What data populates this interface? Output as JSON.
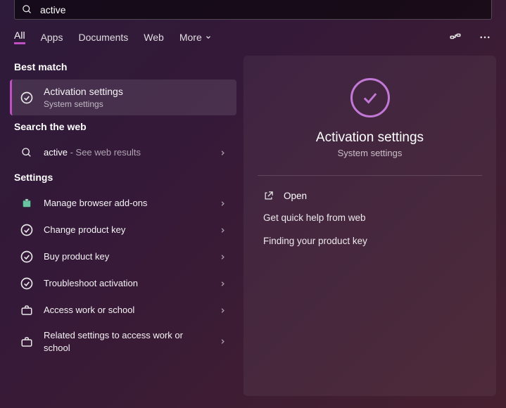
{
  "search": {
    "value": "active"
  },
  "tabs": {
    "all": "All",
    "apps": "Apps",
    "documents": "Documents",
    "web": "Web",
    "more": "More"
  },
  "sections": {
    "best_match": "Best match",
    "search_web": "Search the web",
    "settings": "Settings"
  },
  "best_match": {
    "title": "Activation settings",
    "subtitle": "System settings"
  },
  "web_result": {
    "query": "active",
    "suffix": " - See web results"
  },
  "settings_items": [
    {
      "icon": "addons",
      "label": "Manage browser add-ons"
    },
    {
      "icon": "check",
      "label": "Change product key"
    },
    {
      "icon": "check",
      "label": "Buy product key"
    },
    {
      "icon": "check",
      "label": "Troubleshoot activation"
    },
    {
      "icon": "briefcase",
      "label": "Access work or school"
    },
    {
      "icon": "briefcase",
      "label": "Related settings to access work or school"
    }
  ],
  "detail": {
    "title": "Activation settings",
    "subtitle": "System settings",
    "open": "Open",
    "links": [
      "Get quick help from web",
      "Finding your product key"
    ]
  }
}
